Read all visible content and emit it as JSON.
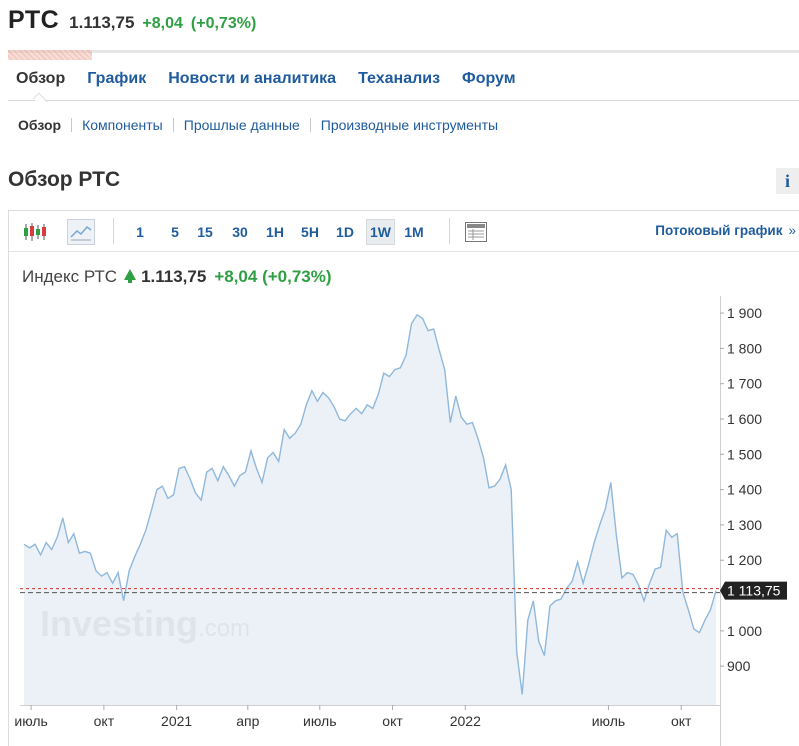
{
  "quote": {
    "name": "РТС",
    "last": "1.113,75",
    "change": "+8,04",
    "change_pct": "(+0,73%)"
  },
  "main_tabs": [
    "Обзор",
    "График",
    "Новости и аналитика",
    "Теханализ",
    "Форум"
  ],
  "sub_tabs": [
    "Обзор",
    "Компоненты",
    "Прошлые данные",
    "Производные инструменты"
  ],
  "section": {
    "title": "Обзор РТС",
    "info_label": "i"
  },
  "toolbar": {
    "icons": [
      "candlestick-icon",
      "area-chart-icon",
      "table-view-icon"
    ],
    "timeframes": [
      "1",
      "5",
      "15",
      "30",
      "1H",
      "5H",
      "1D",
      "1W",
      "1M"
    ],
    "active_timeframe": "1W",
    "stream_label": "Потоковый график",
    "stream_chevron": "»"
  },
  "legend": {
    "name": "Индекс РТС",
    "last": "1.113,75",
    "change": "+8,04",
    "change_pct": "(+0,73%)"
  },
  "watermark": {
    "main": "Investing",
    "suffix": ".com"
  },
  "colors": {
    "up": "#2ea043",
    "link": "#1f5b9e",
    "line": "#8fb8dc",
    "area": "#e8eff6",
    "price_tag": "#222222",
    "price_line": "#cc3333"
  },
  "chart_data": {
    "type": "area",
    "title": "",
    "xlabel": "",
    "ylabel": "",
    "x_ticks": [
      "июль",
      "окт",
      "2021",
      "апр",
      "июль",
      "окт",
      "2022",
      "июль",
      "окт"
    ],
    "y_ticks": [
      "1 900",
      "1 800",
      "1 700",
      "1 600",
      "1 500",
      "1 400",
      "1 300",
      "1 200",
      "1 000",
      "900"
    ],
    "y_tick_values": [
      1900,
      1800,
      1700,
      1600,
      1500,
      1400,
      1300,
      1200,
      1000,
      900
    ],
    "ylim": [
      790,
      1920
    ],
    "last_value": 1113.75,
    "last_label": "1 113,75",
    "grid": false,
    "x_start": "2020-06-22",
    "x_end": "2022-11-14",
    "x_tick_dates": [
      "2020-07-01",
      "2020-10-01",
      "2021-01-01",
      "2021-04-01",
      "2021-07-01",
      "2021-10-01",
      "2022-01-01",
      "2022-07-01",
      "2022-10-01"
    ],
    "x": [
      "2020-06-22",
      "2020-06-29",
      "2020-07-06",
      "2020-07-13",
      "2020-07-20",
      "2020-07-27",
      "2020-08-03",
      "2020-08-10",
      "2020-08-17",
      "2020-08-24",
      "2020-08-31",
      "2020-09-07",
      "2020-09-14",
      "2020-09-21",
      "2020-09-28",
      "2020-10-05",
      "2020-10-12",
      "2020-10-19",
      "2020-10-26",
      "2020-11-02",
      "2020-11-09",
      "2020-11-16",
      "2020-11-23",
      "2020-11-30",
      "2020-12-07",
      "2020-12-14",
      "2020-12-21",
      "2020-12-28",
      "2021-01-04",
      "2021-01-11",
      "2021-01-18",
      "2021-01-25",
      "2021-02-01",
      "2021-02-08",
      "2021-02-15",
      "2021-02-22",
      "2021-03-01",
      "2021-03-08",
      "2021-03-15",
      "2021-03-22",
      "2021-03-29",
      "2021-04-05",
      "2021-04-12",
      "2021-04-19",
      "2021-04-26",
      "2021-05-03",
      "2021-05-10",
      "2021-05-17",
      "2021-05-24",
      "2021-05-31",
      "2021-06-07",
      "2021-06-14",
      "2021-06-21",
      "2021-06-28",
      "2021-07-05",
      "2021-07-12",
      "2021-07-19",
      "2021-07-26",
      "2021-08-02",
      "2021-08-09",
      "2021-08-16",
      "2021-08-23",
      "2021-08-30",
      "2021-09-06",
      "2021-09-13",
      "2021-09-20",
      "2021-09-27",
      "2021-10-04",
      "2021-10-11",
      "2021-10-18",
      "2021-10-25",
      "2021-11-01",
      "2021-11-08",
      "2021-11-15",
      "2021-11-22",
      "2021-11-29",
      "2021-12-06",
      "2021-12-13",
      "2021-12-20",
      "2021-12-27",
      "2022-01-03",
      "2022-01-10",
      "2022-01-17",
      "2022-01-24",
      "2022-01-31",
      "2022-02-07",
      "2022-02-14",
      "2022-02-21",
      "2022-02-28",
      "2022-03-07",
      "2022-03-14",
      "2022-03-21",
      "2022-03-28",
      "2022-04-04",
      "2022-04-11",
      "2022-04-18",
      "2022-04-25",
      "2022-05-02",
      "2022-05-09",
      "2022-05-16",
      "2022-05-23",
      "2022-05-30",
      "2022-06-06",
      "2022-06-13",
      "2022-06-20",
      "2022-06-27",
      "2022-07-04",
      "2022-07-11",
      "2022-07-18",
      "2022-07-25",
      "2022-08-01",
      "2022-08-08",
      "2022-08-15",
      "2022-08-22",
      "2022-08-29",
      "2022-09-05",
      "2022-09-12",
      "2022-09-19",
      "2022-09-26",
      "2022-10-03",
      "2022-10-10",
      "2022-10-17",
      "2022-10-24",
      "2022-10-31",
      "2022-11-07",
      "2022-11-14"
    ],
    "series": [
      {
        "values": [
          1245,
          1235,
          1245,
          1215,
          1250,
          1230,
          1265,
          1320,
          1250,
          1275,
          1220,
          1225,
          1220,
          1170,
          1155,
          1165,
          1135,
          1165,
          1085,
          1170,
          1210,
          1245,
          1285,
          1340,
          1400,
          1410,
          1375,
          1385,
          1460,
          1465,
          1430,
          1390,
          1370,
          1450,
          1460,
          1425,
          1465,
          1440,
          1410,
          1440,
          1450,
          1510,
          1460,
          1420,
          1490,
          1505,
          1480,
          1570,
          1545,
          1560,
          1585,
          1640,
          1680,
          1650,
          1675,
          1660,
          1635,
          1600,
          1595,
          1615,
          1630,
          1615,
          1640,
          1630,
          1670,
          1730,
          1720,
          1740,
          1745,
          1780,
          1870,
          1895,
          1885,
          1850,
          1855,
          1795,
          1740,
          1590,
          1665,
          1605,
          1585,
          1590,
          1545,
          1490,
          1405,
          1410,
          1430,
          1470,
          1400,
          940,
          820,
          1030,
          1085,
          970,
          930,
          1070,
          1085,
          1090,
          1120,
          1140,
          1195,
          1135,
          1190,
          1250,
          1300,
          1345,
          1420,
          1270,
          1150,
          1165,
          1160,
          1130,
          1085,
          1135,
          1175,
          1180,
          1285,
          1265,
          1275,
          1110,
          1060,
          1005,
          995,
          1030,
          1060,
          1113.75
        ]
      }
    ]
  }
}
